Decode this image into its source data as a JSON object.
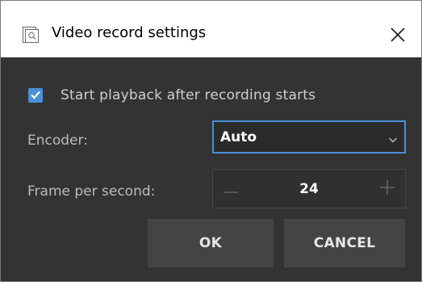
{
  "window": {
    "title": "Video record settings"
  },
  "options": {
    "start_playback_label": "Start playback after recording starts",
    "start_playback_checked": true
  },
  "encoder": {
    "label": "Encoder:",
    "value": "Auto"
  },
  "fps": {
    "label": "Frame per second:",
    "value": "24"
  },
  "buttons": {
    "ok": "OK",
    "cancel": "CANCEL"
  },
  "colors": {
    "accent": "#4a90d9",
    "background": "#333333",
    "button": "#444444"
  },
  "icons": {
    "app": "video-settings-icon",
    "close": "close-icon",
    "check": "checkmark-icon",
    "dropdown": "chevron-down-icon",
    "decrement": "minus-icon",
    "increment": "plus-icon"
  }
}
